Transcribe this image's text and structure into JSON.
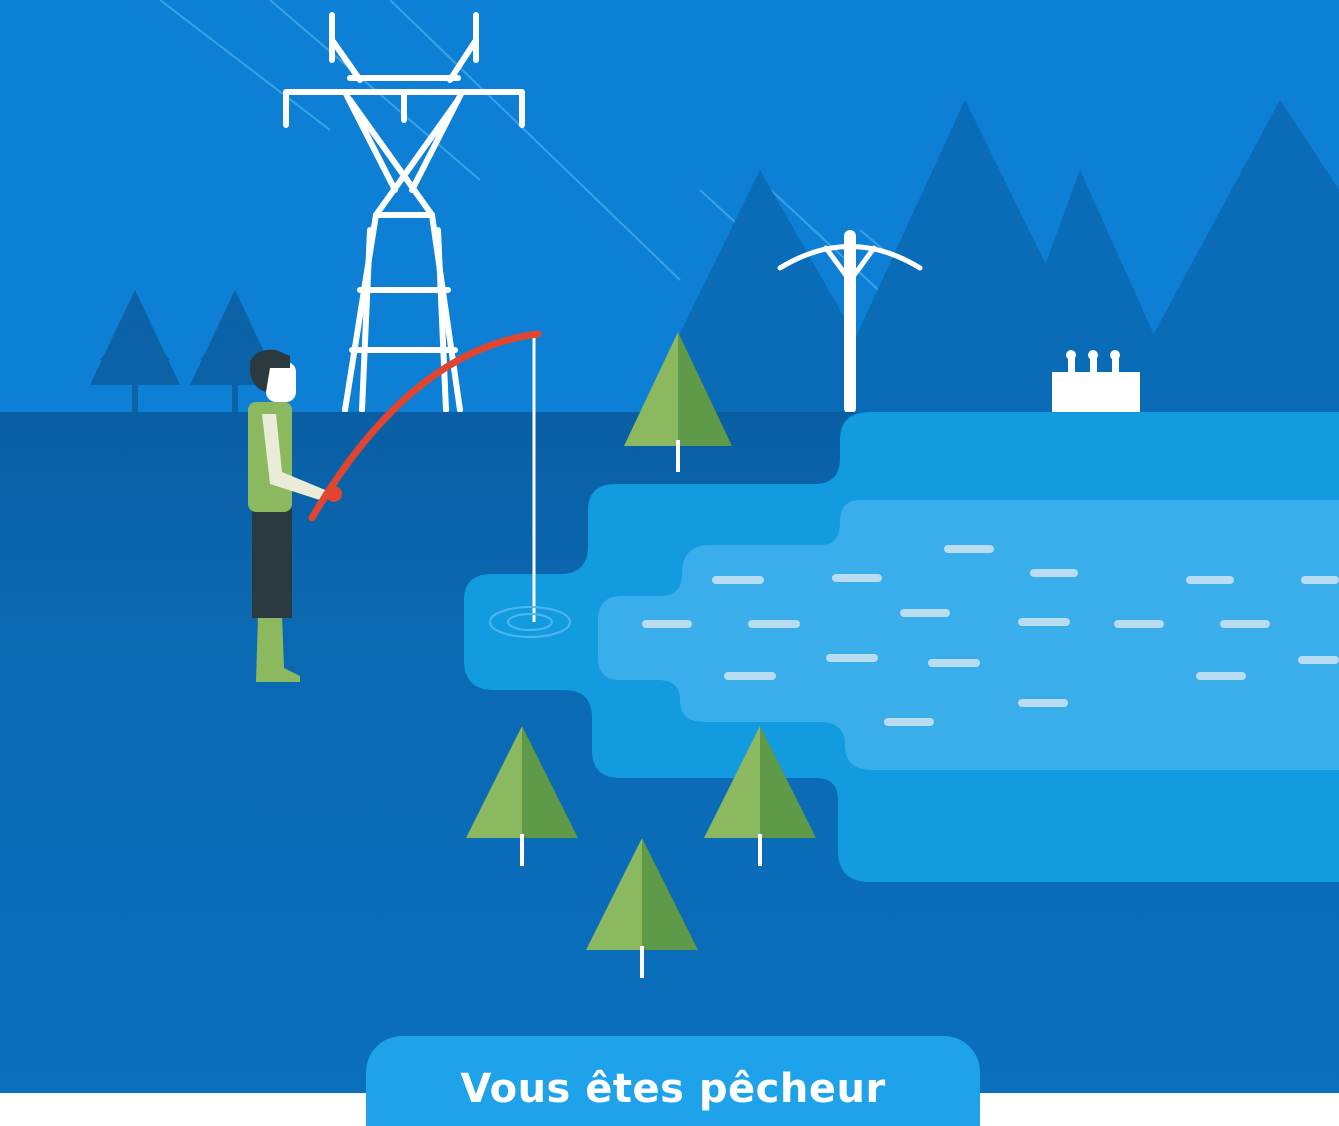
{
  "illustration": {
    "subject": "fisherman-by-reservoir-with-power-lines",
    "colors": {
      "sky": "#0d7fd4",
      "mountain": "#0a6bb7",
      "ground": "#0a63ab",
      "lake_outer": "#129bdf",
      "lake_inner": "#3aaeea",
      "ripple": "#b9dcf2",
      "tree_light": "#8cb85f",
      "tree_dark": "#5e9a47",
      "fishing_rod": "#e0462f",
      "pylon": "#ffffff"
    }
  },
  "banner": {
    "label": "Vous êtes pêcheur"
  }
}
